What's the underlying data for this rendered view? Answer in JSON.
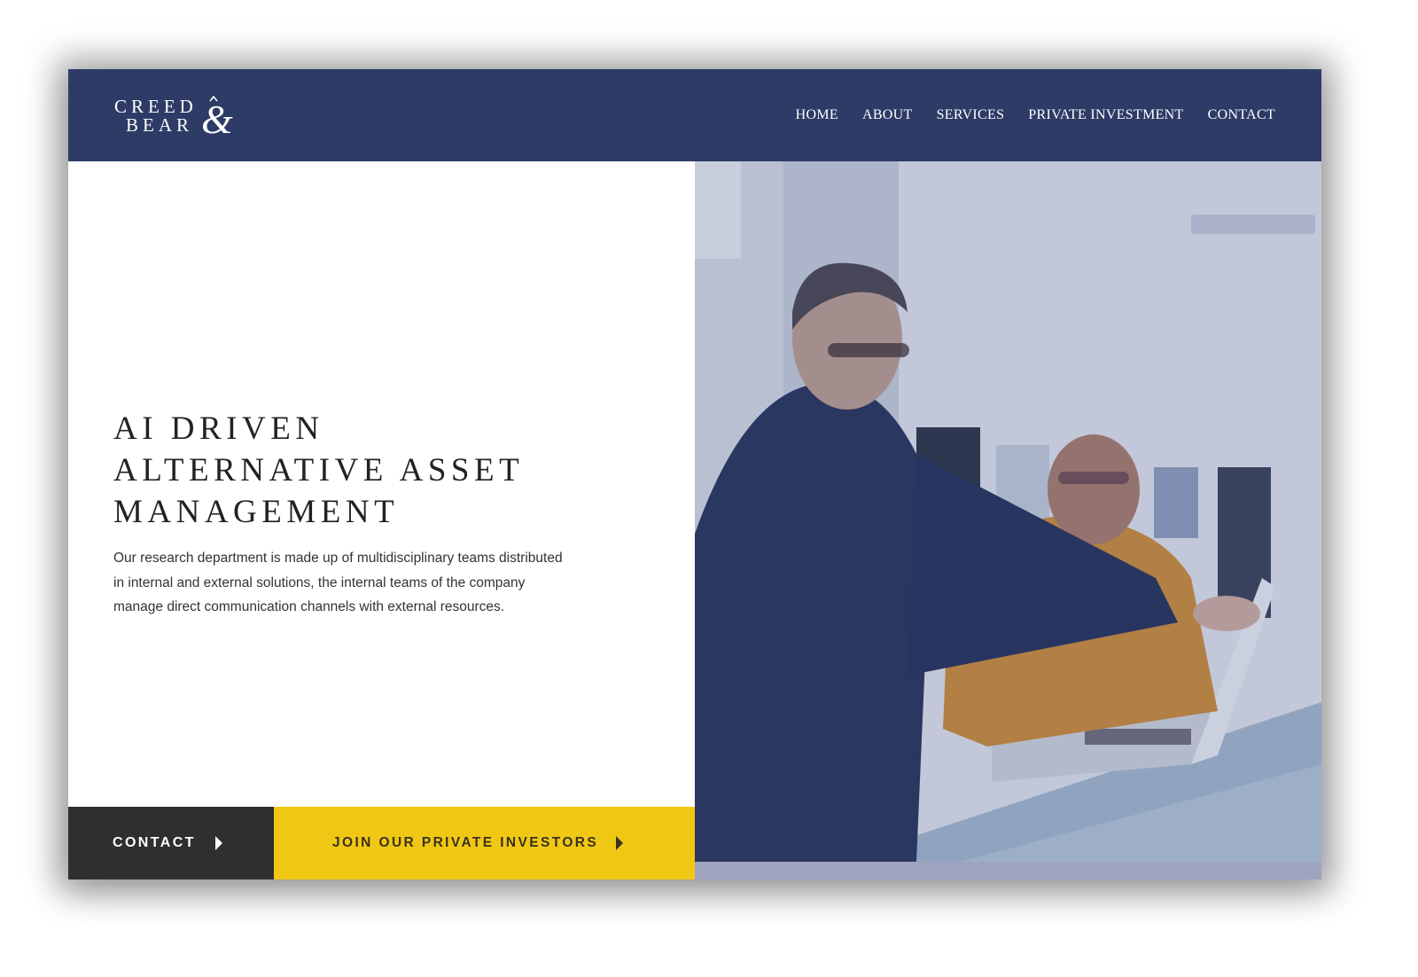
{
  "brand": {
    "logo_line1": "CREED",
    "logo_line2": "BEAR",
    "header_color": "#2d3b66"
  },
  "nav": {
    "items": [
      "HOME",
      "ABOUT",
      "SERVICES",
      "PRIVATE INVESTMENT",
      "CONTACT"
    ]
  },
  "hero": {
    "headline_lines": [
      "AI DRIVEN",
      "ALTERNATIVE ASSET",
      "MANAGEMENT"
    ],
    "description": "Our research department is made up of multidisciplinary teams distributed in internal and external solutions, the internal teams of the company manage direct communication channels with external resources."
  },
  "cta": {
    "contact_label": "CONTACT",
    "join_label": "JOIN OUR PRIVATE INVESTORS",
    "contact_color": "#2f2f2f",
    "join_color": "#f0c814",
    "icon": "chevron-right-icon"
  },
  "photo": {
    "subject": "hero-photo"
  }
}
